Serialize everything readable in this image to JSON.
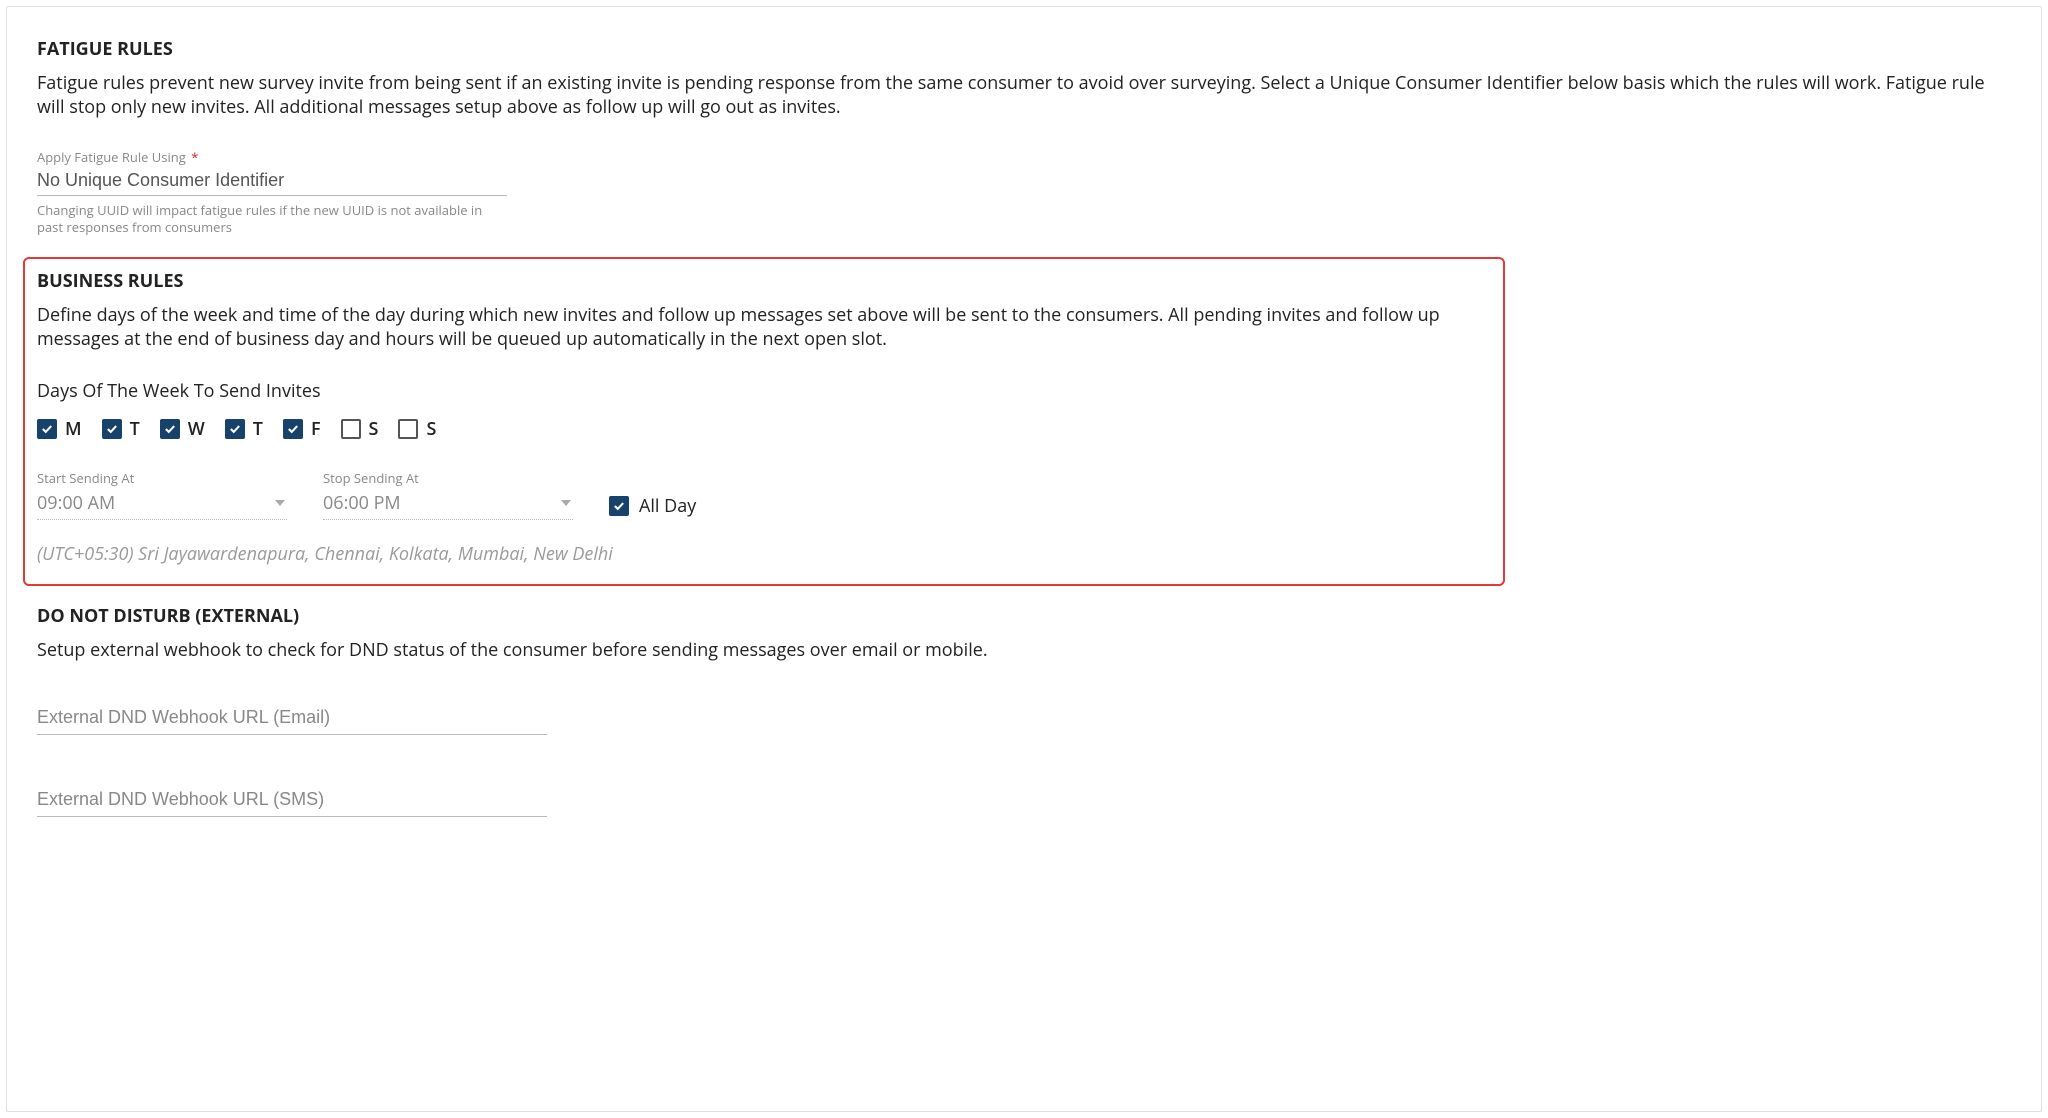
{
  "fatigue": {
    "title": "FATIGUE RULES",
    "desc": "Fatigue rules prevent new survey invite from being sent if an existing invite is pending response from the same consumer to avoid over surveying. Select a Unique Consumer Identifier below basis which the rules will work. Fatigue rule will stop only new invites. All additional messages setup above as follow up will go out as invites.",
    "apply_label": "Apply Fatigue Rule Using",
    "apply_value": "No Unique Consumer Identifier",
    "helper": "Changing UUID will impact fatigue rules if the new UUID is not available in past responses from consumers"
  },
  "business": {
    "title": "BUSINESS RULES",
    "desc": "Define days of the week and time of the day during which new invites and follow up messages set above will be sent to the consumers. All pending invites and follow up messages at the end of business day and hours will be queued up automatically in the next open slot.",
    "days_label": "Days Of The Week To Send Invites",
    "days": [
      {
        "label": "M",
        "checked": true
      },
      {
        "label": "T",
        "checked": true
      },
      {
        "label": "W",
        "checked": true
      },
      {
        "label": "T",
        "checked": true
      },
      {
        "label": "F",
        "checked": true
      },
      {
        "label": "S",
        "checked": false
      },
      {
        "label": "S",
        "checked": false
      }
    ],
    "start_label": "Start Sending At",
    "start_value": "09:00 AM",
    "stop_label": "Stop Sending At",
    "stop_value": "06:00 PM",
    "all_day_label": "All Day",
    "all_day_checked": true,
    "timezone": "(UTC+05:30) Sri Jayawardenapura, Chennai, Kolkata, Mumbai, New Delhi"
  },
  "dnd": {
    "title": "DO NOT DISTURB (EXTERNAL)",
    "desc": "Setup external webhook to check for DND status of the consumer before sending messages over email or mobile.",
    "email_placeholder": "External DND Webhook URL (Email)",
    "sms_placeholder": "External DND Webhook URL (SMS)"
  }
}
